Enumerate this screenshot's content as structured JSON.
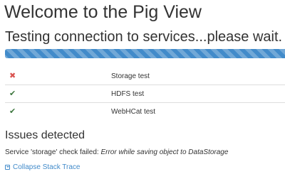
{
  "page": {
    "title": "Welcome to the Pig View",
    "status_heading": "Testing connection to services...please wait."
  },
  "progress": {
    "value_percent": 100,
    "color": "#428bca"
  },
  "tests": [
    {
      "status": "failed",
      "icon": "x-icon",
      "symbol": "✖",
      "label": "Storage test"
    },
    {
      "status": "passed",
      "icon": "check-icon",
      "symbol": "✔",
      "label": "HDFS test"
    },
    {
      "status": "passed",
      "icon": "check-icon",
      "symbol": "✔",
      "label": "WebHCat test"
    }
  ],
  "issues": {
    "heading": "Issues detected",
    "message_prefix": "Service 'storage' check failed: ",
    "message_detail": "Error while saving object to DataStorage",
    "collapse_link": "Collapse Stack Trace",
    "collapse_icon": "collapse-icon"
  },
  "colors": {
    "fail": "#d9534f",
    "ok": "#3c763d",
    "link": "#428bca"
  }
}
